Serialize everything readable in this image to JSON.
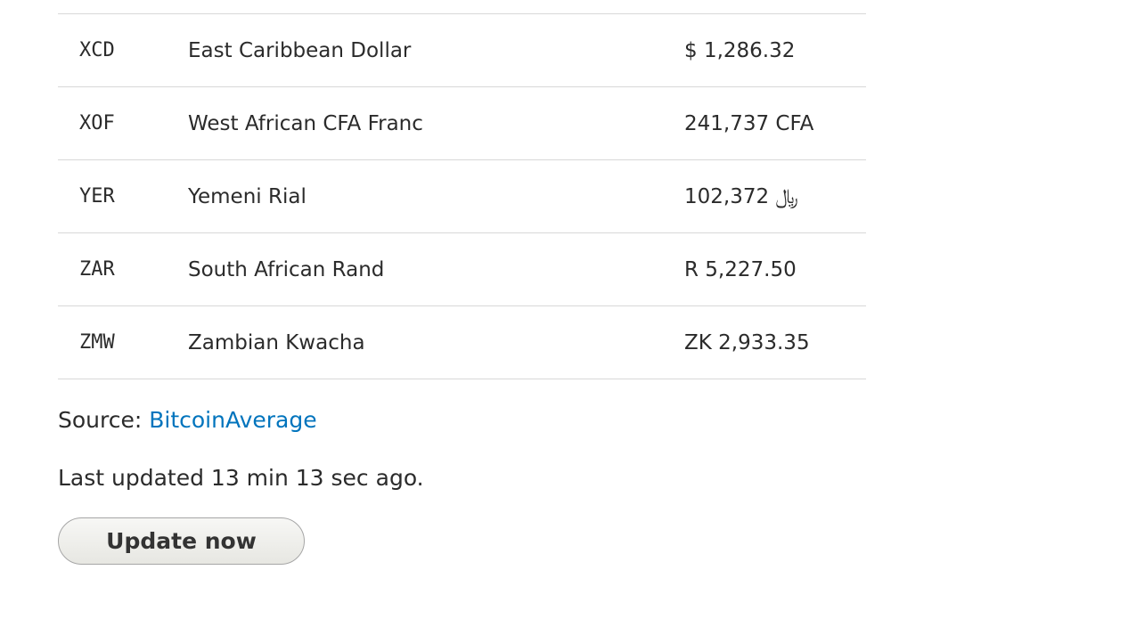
{
  "rows": [
    {
      "code": "XCD",
      "name": "East Caribbean Dollar",
      "value": "$ 1,286.32"
    },
    {
      "code": "XOF",
      "name": "West African CFA Franc",
      "value": "241,737 CFA"
    },
    {
      "code": "YER",
      "name": "Yemeni Rial",
      "value": "102,372 ﷼"
    },
    {
      "code": "ZAR",
      "name": "South African Rand",
      "value": "R 5,227.50"
    },
    {
      "code": "ZMW",
      "name": "Zambian Kwacha",
      "value": "ZK 2,933.35"
    }
  ],
  "source": {
    "label": "Source: ",
    "link_text": "BitcoinAverage"
  },
  "last_updated": "Last updated 13 min 13 sec ago.",
  "update_button": "Update now"
}
